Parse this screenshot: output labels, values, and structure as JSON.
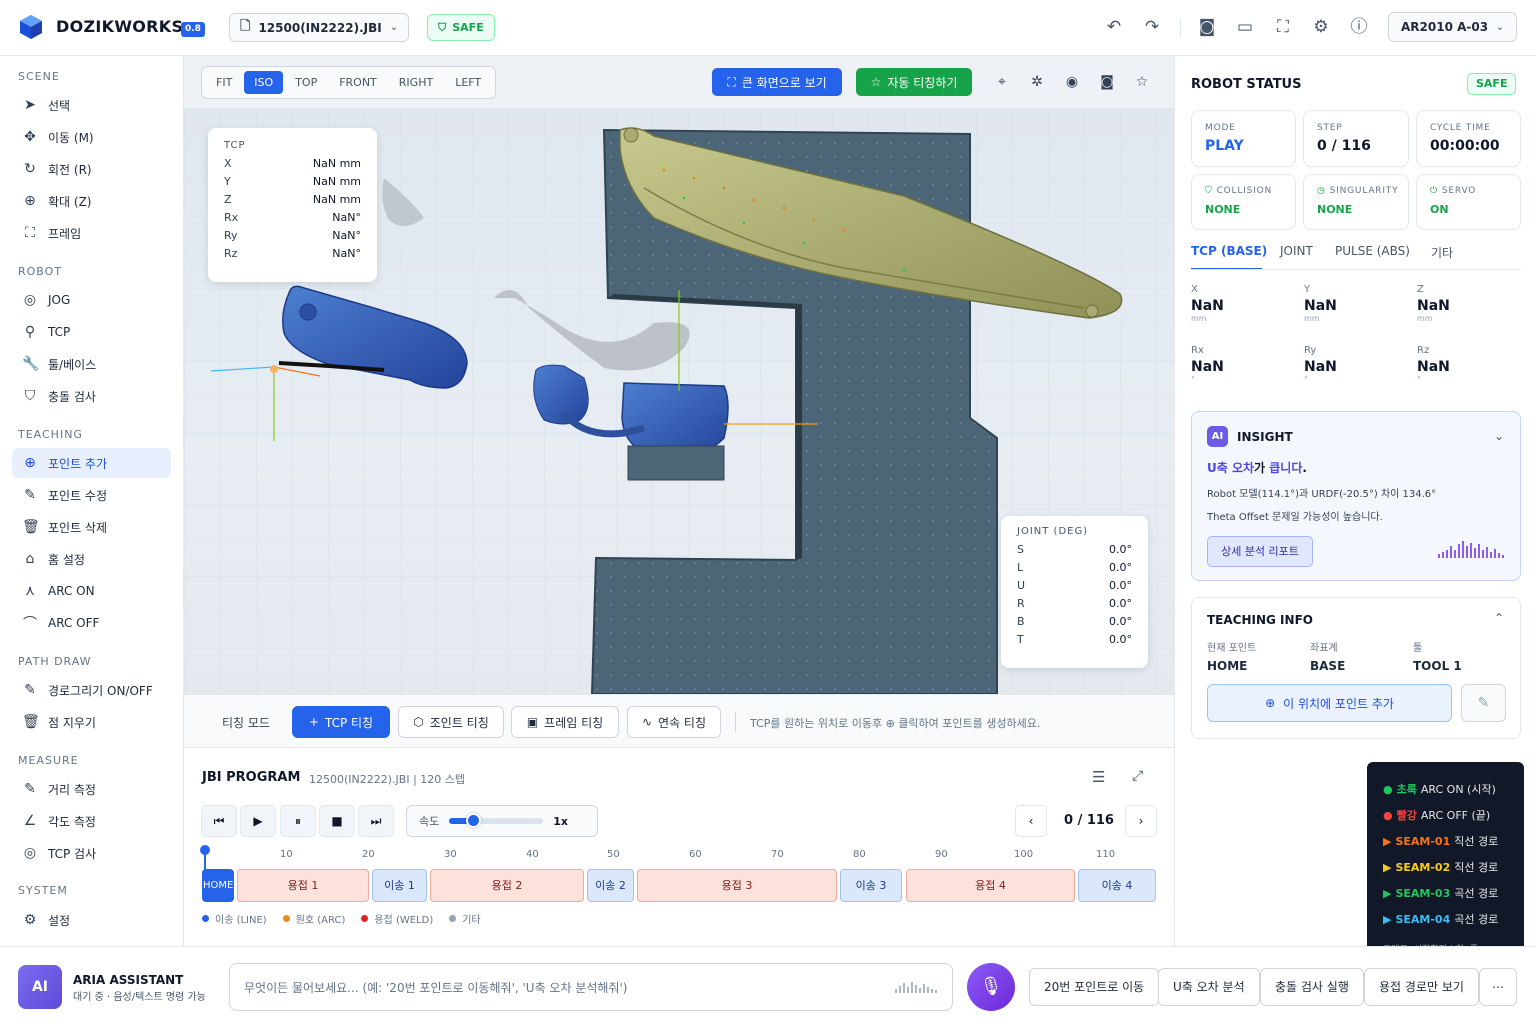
{
  "app": {
    "brand": "DOZIKWORKS",
    "version": "0.8",
    "file": "12500(IN2222).JBI",
    "safe": "SAFE",
    "robot": "AR2010 A-03"
  },
  "sidebar": {
    "sections": [
      {
        "title": "SCENE",
        "items": [
          "선택",
          "이동 (M)",
          "회전 (R)",
          "확대 (Z)",
          "프레임"
        ]
      },
      {
        "title": "ROBOT",
        "items": [
          "JOG",
          "TCP",
          "툴/베이스",
          "충돌 검사"
        ]
      },
      {
        "title": "TEACHING",
        "items": [
          "포인트 추가",
          "포인트 수정",
          "포인트 삭제",
          "홈 설정",
          "ARC ON",
          "ARC OFF"
        ]
      },
      {
        "title": "PATH DRAW",
        "items": [
          "경로그리기 ON/OFF",
          "점 지우기"
        ]
      },
      {
        "title": "MEASURE",
        "items": [
          "거리 측정",
          "각도 측정",
          "TCP 검사"
        ]
      },
      {
        "title": "SYSTEM",
        "items": [
          "설정"
        ]
      }
    ]
  },
  "viewport": {
    "views": [
      "FIT",
      "ISO",
      "TOP",
      "FRONT",
      "RIGHT",
      "LEFT"
    ],
    "active_view": "ISO",
    "big_screen": "큰 화면으로 보기",
    "auto_teach": "자동 티칭하기"
  },
  "tcp_panel": {
    "title": "TCP",
    "rows": [
      {
        "k": "X",
        "v": "NaN mm"
      },
      {
        "k": "Y",
        "v": "NaN mm"
      },
      {
        "k": "Z",
        "v": "NaN mm"
      },
      {
        "k": "Rx",
        "v": "NaN°"
      },
      {
        "k": "Ry",
        "v": "NaN°"
      },
      {
        "k": "Rz",
        "v": "NaN°"
      }
    ]
  },
  "joint_panel": {
    "title": "JOINT (DEG)",
    "rows": [
      {
        "k": "S",
        "v": "0.0°"
      },
      {
        "k": "L",
        "v": "0.0°"
      },
      {
        "k": "U",
        "v": "0.0°"
      },
      {
        "k": "R",
        "v": "0.0°"
      },
      {
        "k": "B",
        "v": "0.0°"
      },
      {
        "k": "T",
        "v": "0.0°"
      }
    ]
  },
  "teaching": {
    "label": "티칭 모드",
    "buttons": [
      "TCP 티칭",
      "조인트 티칭",
      "프레임 티칭",
      "연속 티칭"
    ],
    "hint": "TCP를 원하는 위치로 이동후 ⊕ 클릭하여 포인트를 생성하세요."
  },
  "program": {
    "title": "JBI PROGRAM",
    "meta": "12500(IN2222).JBI | 120 스텝",
    "speed_label": "속도",
    "speed_value": "1x",
    "speed_fraction": 0.25,
    "step": "0 / 116",
    "ticks": [
      "10",
      "20",
      "30",
      "40",
      "50",
      "60",
      "70",
      "80",
      "90",
      "100",
      "110"
    ],
    "segments": [
      {
        "label": "HOME",
        "kind": "h"
      },
      {
        "label": "용접 1",
        "kind": "w"
      },
      {
        "label": "이송 1",
        "kind": "m"
      },
      {
        "label": "용접 2",
        "kind": "w"
      },
      {
        "label": "이송 2",
        "kind": "m"
      },
      {
        "label": "용접 3",
        "kind": "w"
      },
      {
        "label": "이송 3",
        "kind": "m"
      },
      {
        "label": "용접 4",
        "kind": "w"
      },
      {
        "label": "이송 4",
        "kind": "m"
      }
    ],
    "legend": [
      {
        "label": "이송 (LINE)",
        "color": "#2563eb"
      },
      {
        "label": "원호 (ARC)",
        "color": "#ea8a1e"
      },
      {
        "label": "용접 (WELD)",
        "color": "#dc2626"
      },
      {
        "label": "기타",
        "color": "#94a3b8"
      }
    ]
  },
  "status": {
    "title": "ROBOT STATUS",
    "badge": "SAFE",
    "mode_label": "MODE",
    "mode": "PLAY",
    "step_label": "STEP",
    "step": "0 / 116",
    "cycle_label": "CYCLE TIME",
    "cycle": "00:00:00",
    "collision_label": "COLLISION",
    "collision": "NONE",
    "singularity_label": "SINGULARITY",
    "singularity": "NONE",
    "servo_label": "SERVO",
    "servo": "ON",
    "tabs": [
      "TCP (BASE)",
      "JOINT",
      "PULSE (ABS)",
      "기타"
    ],
    "coords": [
      {
        "k": "X",
        "v": "NaN",
        "u": "mm"
      },
      {
        "k": "Y",
        "v": "NaN",
        "u": "mm"
      },
      {
        "k": "Z",
        "v": "NaN",
        "u": "mm"
      },
      {
        "k": "Rx",
        "v": "NaN",
        "u": "°"
      },
      {
        "k": "Ry",
        "v": "NaN",
        "u": "°"
      },
      {
        "k": "Rz",
        "v": "NaN",
        "u": "°"
      }
    ]
  },
  "insight": {
    "title": "INSIGHT",
    "headline_a": "U축 오차",
    "headline_b": "가 ",
    "headline_c": "큽니다",
    "headline_d": ".",
    "line1": "Robot 모델(114.1°)과 URDF(-20.5°) 차이 134.6°",
    "line2": "Theta Offset 문제일 가능성이 높습니다.",
    "button": "상세 분석 리포트"
  },
  "teaching_info": {
    "title": "TEACHING INFO",
    "cols": [
      {
        "k": "현재 포인트",
        "v": "HOME"
      },
      {
        "k": "좌표계",
        "v": "BASE"
      },
      {
        "k": "툴",
        "v": "TOOL 1"
      }
    ],
    "add_button": "이 위치에 포인트 추가"
  },
  "legend": {
    "rows": [
      {
        "sym": "●",
        "key": "초록",
        "text": " ARC ON (시작)",
        "color": "#22c55e"
      },
      {
        "sym": "●",
        "key": "빨강",
        "text": " ARC OFF (끝)",
        "color": "#ef4444"
      },
      {
        "sym": "▶",
        "key": "SEAM-01",
        "text": " 직선 경로",
        "color": "#f97316"
      },
      {
        "sym": "▶",
        "key": "SEAM-02",
        "text": " 직선 경로",
        "color": "#facc15"
      },
      {
        "sym": "▶",
        "key": "SEAM-03",
        "text": " 곡선 경로",
        "color": "#22c55e"
      },
      {
        "sym": "▶",
        "key": "SEAM-04",
        "text": " 곡선 경로",
        "color": "#38bdf8"
      }
    ],
    "footer": "드래그: 시점회전 | 휠: 줌"
  },
  "assistant": {
    "avatar": "AI",
    "name": "ARIA ASSISTANT",
    "status": "대기 중 · 음성/텍스트 명령 가능",
    "placeholder": "무엇이든 물어보세요... (예: '20번 포인트로 이동해줘', 'U축 오차 분석해줘')",
    "quick": [
      "20번 포인트로 이동",
      "U축 오차 분석",
      "충돌 검사 실행",
      "용접 경로만 보기"
    ],
    "more": "⋯"
  }
}
